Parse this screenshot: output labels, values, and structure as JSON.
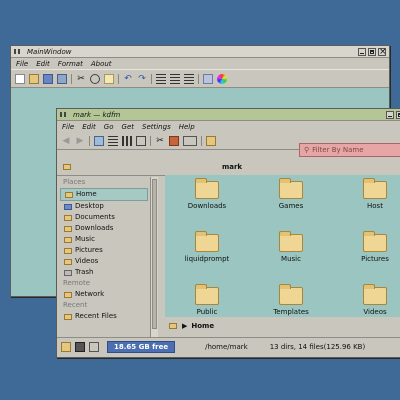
{
  "main_window": {
    "title": "MainWindow",
    "menu": [
      "File",
      "Edit",
      "Format",
      "About"
    ]
  },
  "fm_window": {
    "title": "mark — kdfm",
    "menu": [
      "File",
      "Edit",
      "Go",
      "Get",
      "Settings",
      "Help"
    ],
    "filter_placeholder": "Filter By Name",
    "path_title": "mark",
    "sidebar": {
      "places_heading": "Places",
      "places": [
        "Home",
        "Desktop",
        "Documents",
        "Downloads",
        "Music",
        "Pictures",
        "Videos",
        "Trash"
      ],
      "remote_heading": "Remote",
      "remote": [
        "Network"
      ],
      "recent_heading": "Recent",
      "recent": [
        "Recent Files"
      ]
    },
    "folders": [
      "Downloads",
      "Games",
      "Host",
      "liquidprompt",
      "Music",
      "Pictures",
      "Public",
      "Templates",
      "Videos"
    ],
    "breadcrumb": "Home",
    "status": {
      "free_space": "18.65 GB free",
      "path": "/home/mark",
      "summary": "13 dirs, 14 files(125.96 KB)"
    }
  },
  "colors": {
    "desktop": "#3f6a97",
    "content_bg": "#9ac5c0",
    "fm_titlebar": "#b4c596",
    "filter_bg": "#e8a5a5",
    "free_badge": "#4b6fb0"
  }
}
